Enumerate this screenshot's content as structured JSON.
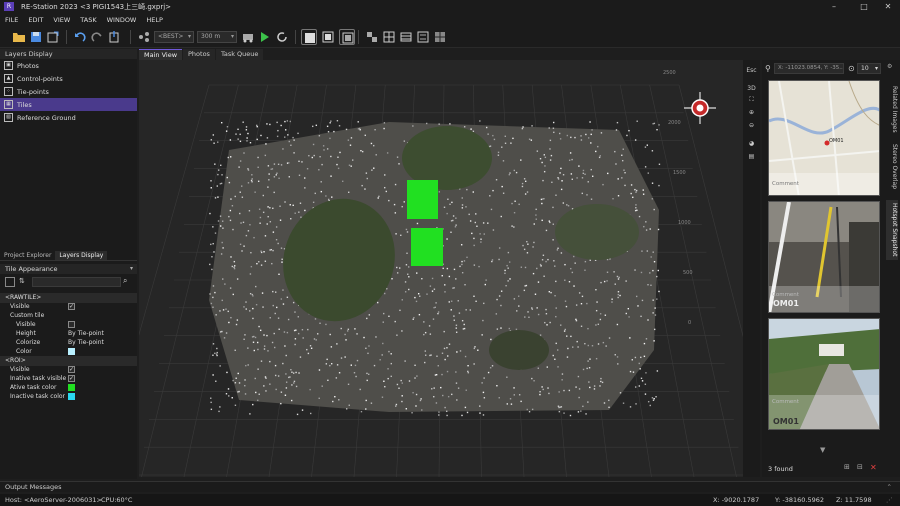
{
  "window": {
    "logo": "R",
    "title": "RE-Station 2023  <3 PIGI1543上三崎.gxprj>",
    "buttons": {
      "minimize": "–",
      "maximize": "□",
      "close": "✕"
    }
  },
  "menu": [
    "FILE",
    "EDIT",
    "VIEW",
    "TASK",
    "WINDOW",
    "HELP"
  ],
  "toolbar": {
    "quality_select": "<BEST>",
    "distance_select": "300 m",
    "icons": [
      "open-folder-icon",
      "save-icon",
      "export-icon",
      "undo-icon",
      "redo-icon",
      "import-icon",
      "cluster-icon",
      "run-icon",
      "reset-icon",
      "layout-1-icon",
      "layout-2-icon",
      "layout-3-icon",
      "grid-a-icon",
      "grid-b-icon",
      "grid-c-icon",
      "grid-d-icon",
      "grid-e-icon"
    ]
  },
  "left_panel": {
    "header": "Layers Display",
    "layers": [
      {
        "label": "Photos",
        "icon": "▣"
      },
      {
        "label": "Control-points",
        "icon": "▲"
      },
      {
        "label": "Tie-points",
        "icon": "⁘"
      },
      {
        "label": "Tiles",
        "icon": "▦",
        "selected": true
      },
      {
        "label": "Reference Ground",
        "icon": "▧"
      }
    ],
    "tabs": [
      "Project Explorer",
      "Layers Display"
    ],
    "active_tab": "Layers Display",
    "props_header": "Tile Appearance",
    "props": {
      "section_rawtile": "<RAWTILE>",
      "visible": "Visible",
      "custom_tile": "Custom tile",
      "visible2": "Visible",
      "height": "Height",
      "height_val": "By Tie-point",
      "colorize": "Colorize",
      "colorize_val": "By Tie-point",
      "color": "Color",
      "section_roi": "<ROI>",
      "roi_visible": "Visible",
      "inactive_task_visible": "Inative task visible",
      "active_task_color": "Ative task color",
      "inactive_task_color": "Inactive task color"
    }
  },
  "colors": {
    "tile_color": "#b9f0ff",
    "active_task": "#21e021",
    "inactive_task": "#2ad8f0",
    "selection": "#4a3a8c",
    "accent": "#7058d8"
  },
  "view_tabs": [
    "Main View",
    "Photos",
    "Task Queue"
  ],
  "active_view_tab": "Main View",
  "scale_ticks": [
    "2500",
    "2000",
    "1500",
    "1000",
    "500",
    "0"
  ],
  "nav_buttons": [
    "Esc",
    "3D",
    "fit-icon",
    "zoom-in-icon",
    "zoom-out-icon",
    "color-icon",
    "layers-icon"
  ],
  "right_panel": {
    "coordinate": "X: -11023.0854, Y: -35...",
    "zoom": "10",
    "map_marker": "OM01",
    "photo_labels": [
      "OM01",
      "OM01"
    ],
    "comment_placeholder": "Comment",
    "found": "3 found"
  },
  "side_tabs": [
    "Related Images",
    "Stereo Overlap",
    "Hotspot Snapshot"
  ],
  "active_side_tab": "Hotspot Snapshot",
  "output": "Output Messages",
  "status": {
    "host": "Host: <AeroServer-2006031>",
    "cpu": "CPU:60°C",
    "x": "X: -9020.1787",
    "y": "Y: -38160.5962",
    "z": "Z: 11.7598"
  }
}
